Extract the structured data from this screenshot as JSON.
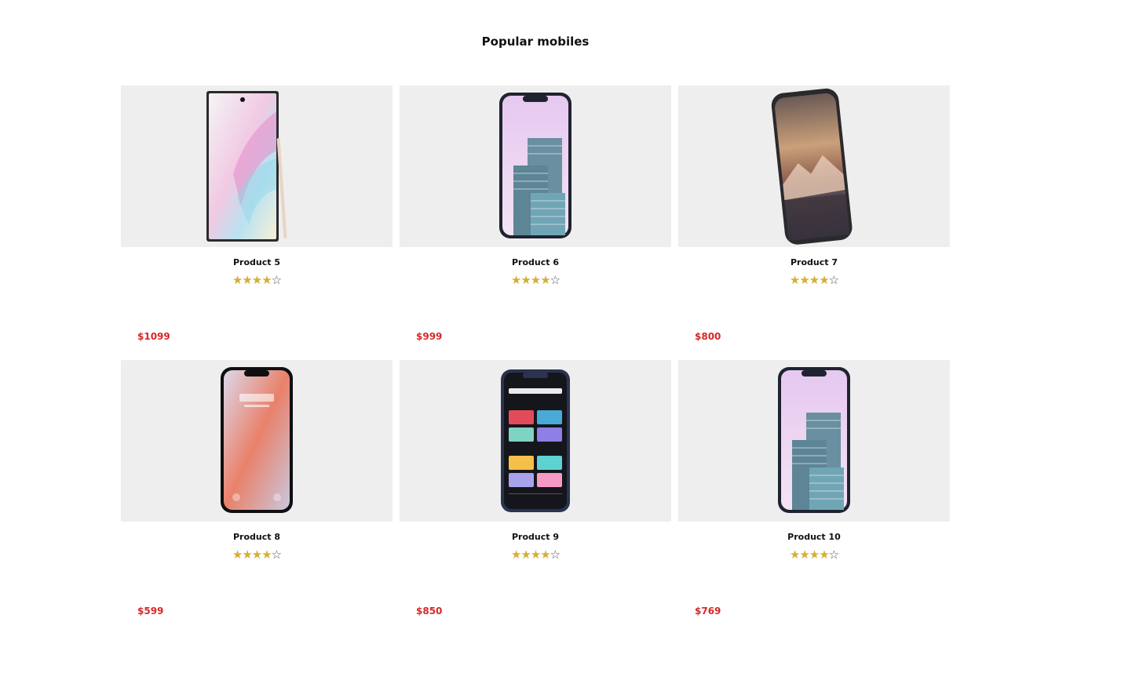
{
  "page": {
    "title": "Popular mobiles"
  },
  "colors": {
    "card_bg": "#eeeeee",
    "price": "#d62828",
    "star": "#d4af37"
  },
  "products": [
    {
      "name": "Product 5",
      "price": "$1099",
      "rating": 4,
      "max_rating": 5,
      "image_icon": "phone-with-stylus-icon"
    },
    {
      "name": "Product 6",
      "price": "$999",
      "rating": 4,
      "max_rating": 5,
      "image_icon": "phone-buildings-icon"
    },
    {
      "name": "Product 7",
      "price": "$800",
      "rating": 4,
      "max_rating": 5,
      "image_icon": "phone-mountains-icon"
    },
    {
      "name": "Product 8",
      "price": "$599",
      "rating": 4,
      "max_rating": 5,
      "image_icon": "phone-lockscreen-icon"
    },
    {
      "name": "Product 9",
      "price": "$850",
      "rating": 4,
      "max_rating": 5,
      "image_icon": "phone-music-app-icon"
    },
    {
      "name": "Product 10",
      "price": "$769",
      "rating": 4,
      "max_rating": 5,
      "image_icon": "phone-buildings-icon"
    }
  ]
}
